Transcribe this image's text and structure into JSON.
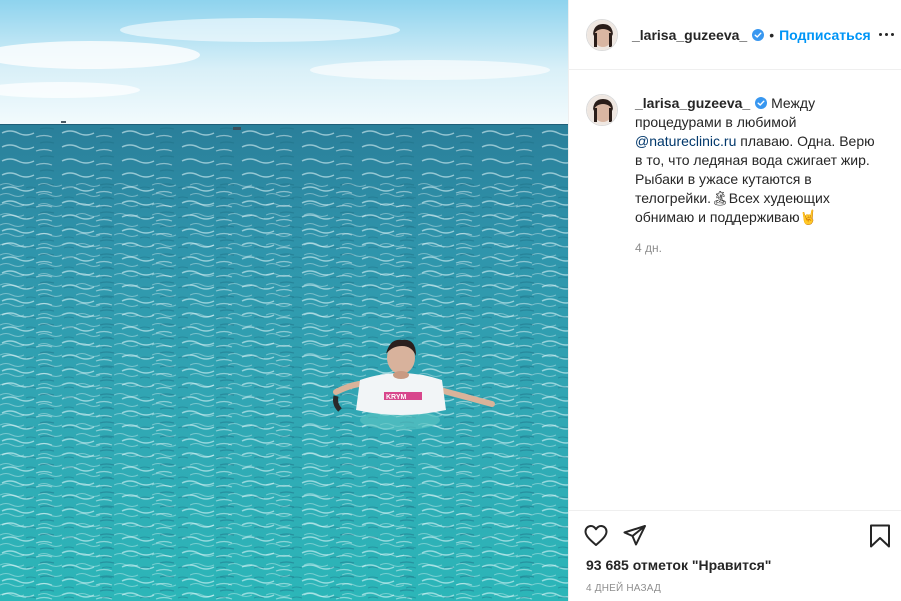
{
  "post": {
    "username": "_larisa_guzeeva_",
    "verified": true,
    "follow_label": "Подписаться",
    "separator": "•",
    "caption": {
      "username": "_larisa_guzeeva_",
      "text_before_mention": "Между процедурами в любимой ",
      "mention": "@natureclinic.ru",
      "text_after_mention": " плаваю. Одна. Верю в то, что ледяная вода сжигает жир. Рыбаки в ужасе кутаются в телогрейки.🏝Всех худеющих обнимаю и поддерживаю🤘",
      "time": "4 дн."
    },
    "likes": "93 685 отметок \"Нравится\"",
    "date": "4 дней назад",
    "shirt_text": "KRYM"
  },
  "icons": {
    "more": "more-options-icon",
    "like": "heart-icon",
    "share": "paper-plane-icon",
    "save": "bookmark-icon",
    "verified": "verified-badge-icon"
  },
  "colors": {
    "accent": "#0095f6",
    "text": "#262626",
    "muted": "#8e8e8e",
    "border": "#efefef",
    "sea_top": "#3aa6b2",
    "sea_bottom": "#2fb3b6",
    "sky": "#e6f5fb"
  }
}
